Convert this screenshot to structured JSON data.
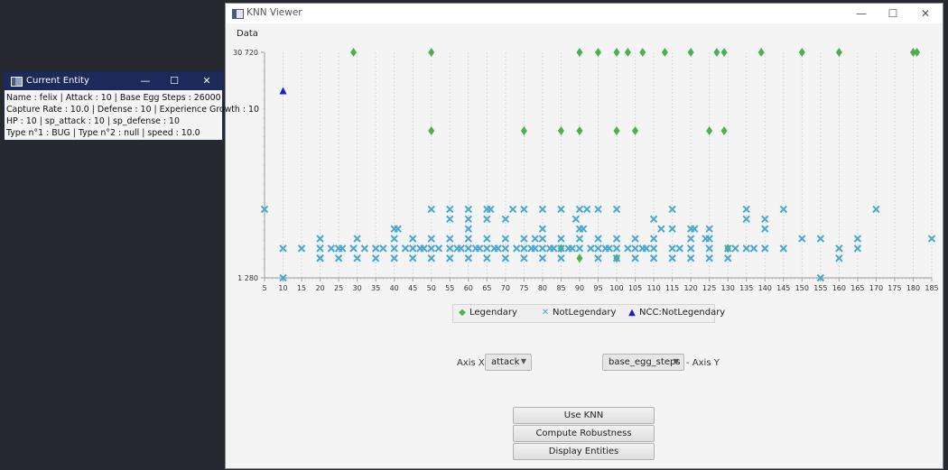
{
  "main_window": {
    "title": "KNN Viewer",
    "menu": [
      "Data"
    ],
    "controls": {
      "minimize": "—",
      "maximize": "☐",
      "close": "✕"
    }
  },
  "chart_data": {
    "type": "scatter",
    "x_ticks": [
      "5",
      "10",
      "15",
      "20",
      "25",
      "30",
      "35",
      "40",
      "45",
      "50",
      "55",
      "60",
      "65",
      "70",
      "75",
      "80",
      "85",
      "90",
      "95",
      "100",
      "105",
      "110",
      "115",
      "120",
      "125",
      "130",
      "135",
      "140",
      "145",
      "150",
      "155",
      "160",
      "165",
      "170",
      "175",
      "180",
      "185"
    ],
    "y_tick_labels": [
      "30 720",
      "1 280"
    ],
    "xlim": [
      5,
      185
    ],
    "ylim": [
      1280,
      30720
    ],
    "grid": true,
    "legend_position": "bottom",
    "series": [
      {
        "name": "Legendary",
        "marker": "diamond",
        "color": "#4cb050",
        "points": [
          [
            29,
            30720
          ],
          [
            50,
            30720
          ],
          [
            90,
            30720
          ],
          [
            95,
            30720
          ],
          [
            100,
            30720
          ],
          [
            103,
            30720
          ],
          [
            107,
            30720
          ],
          [
            113,
            30720
          ],
          [
            120,
            30720
          ],
          [
            127,
            30720
          ],
          [
            129,
            30720
          ],
          [
            139,
            30720
          ],
          [
            150,
            30720
          ],
          [
            160,
            30720
          ],
          [
            180,
            30720
          ],
          [
            181,
            30720
          ],
          [
            50,
            20480
          ],
          [
            75,
            20480
          ],
          [
            85,
            20480
          ],
          [
            90,
            20480
          ],
          [
            100,
            20480
          ],
          [
            105,
            20480
          ],
          [
            125,
            20480
          ],
          [
            129,
            20480
          ],
          [
            85,
            5120
          ],
          [
            90,
            3840
          ],
          [
            100,
            3840
          ],
          [
            130,
            5120
          ]
        ]
      },
      {
        "name": "NotLegendary",
        "marker": "x",
        "color": "#4aa8d0",
        "points": [
          [
            5,
            10240
          ],
          [
            10,
            5120
          ],
          [
            10,
            1280
          ],
          [
            15,
            5120
          ],
          [
            20,
            6400
          ],
          [
            20,
            5120
          ],
          [
            20,
            3840
          ],
          [
            20,
            3840
          ],
          [
            23,
            5120
          ],
          [
            25,
            5120
          ],
          [
            25,
            3840
          ],
          [
            26,
            5120
          ],
          [
            29,
            5120
          ],
          [
            30,
            6400
          ],
          [
            30,
            3840
          ],
          [
            32,
            5120
          ],
          [
            35,
            5120
          ],
          [
            35,
            3840
          ],
          [
            37,
            5120
          ],
          [
            40,
            7680
          ],
          [
            40,
            6400
          ],
          [
            40,
            5120
          ],
          [
            40,
            3840
          ],
          [
            41,
            7680
          ],
          [
            43,
            5120
          ],
          [
            45,
            6400
          ],
          [
            45,
            5120
          ],
          [
            45,
            3840
          ],
          [
            47,
            5120
          ],
          [
            48,
            5120
          ],
          [
            50,
            10240
          ],
          [
            50,
            6400
          ],
          [
            50,
            5120
          ],
          [
            50,
            3840
          ],
          [
            52,
            5120
          ],
          [
            55,
            10240
          ],
          [
            55,
            8960
          ],
          [
            55,
            6400
          ],
          [
            55,
            5120
          ],
          [
            55,
            3840
          ],
          [
            57,
            5120
          ],
          [
            58,
            5120
          ],
          [
            60,
            10240
          ],
          [
            60,
            8960
          ],
          [
            60,
            7680
          ],
          [
            60,
            6400
          ],
          [
            60,
            5120
          ],
          [
            60,
            3840
          ],
          [
            62,
            5120
          ],
          [
            63,
            5120
          ],
          [
            65,
            10240
          ],
          [
            65,
            8960
          ],
          [
            65,
            6400
          ],
          [
            65,
            5120
          ],
          [
            65,
            3840
          ],
          [
            66,
            10240
          ],
          [
            67,
            5120
          ],
          [
            68,
            5120
          ],
          [
            70,
            8960
          ],
          [
            70,
            6400
          ],
          [
            70,
            5120
          ],
          [
            70,
            3840
          ],
          [
            72,
            10240
          ],
          [
            73,
            5120
          ],
          [
            75,
            10240
          ],
          [
            75,
            6400
          ],
          [
            75,
            5120
          ],
          [
            75,
            3840
          ],
          [
            77,
            5120
          ],
          [
            78,
            5120
          ],
          [
            78,
            6400
          ],
          [
            80,
            10240
          ],
          [
            80,
            7680
          ],
          [
            80,
            6400
          ],
          [
            80,
            5120
          ],
          [
            80,
            3840
          ],
          [
            82,
            5120
          ],
          [
            83,
            5120
          ],
          [
            85,
            10240
          ],
          [
            85,
            6400
          ],
          [
            85,
            5120
          ],
          [
            85,
            3840
          ],
          [
            87,
            5120
          ],
          [
            88,
            5120
          ],
          [
            89,
            8960
          ],
          [
            90,
            10240
          ],
          [
            90,
            7680
          ],
          [
            90,
            6400
          ],
          [
            90,
            5120
          ],
          [
            91,
            7680
          ],
          [
            92,
            10240
          ],
          [
            93,
            5120
          ],
          [
            95,
            10240
          ],
          [
            95,
            6400
          ],
          [
            95,
            5120
          ],
          [
            95,
            3840
          ],
          [
            97,
            5120
          ],
          [
            98,
            5120
          ],
          [
            100,
            10240
          ],
          [
            100,
            6400
          ],
          [
            100,
            5120
          ],
          [
            100,
            3840
          ],
          [
            103,
            5120
          ],
          [
            105,
            6400
          ],
          [
            105,
            5120
          ],
          [
            105,
            3840
          ],
          [
            107,
            5120
          ],
          [
            108,
            5120
          ],
          [
            110,
            8960
          ],
          [
            110,
            6400
          ],
          [
            110,
            5120
          ],
          [
            110,
            3840
          ],
          [
            112,
            7680
          ],
          [
            115,
            10240
          ],
          [
            115,
            7680
          ],
          [
            115,
            5120
          ],
          [
            115,
            3840
          ],
          [
            117,
            5120
          ],
          [
            120,
            7680
          ],
          [
            120,
            6400
          ],
          [
            120,
            5120
          ],
          [
            120,
            3840
          ],
          [
            121,
            7680
          ],
          [
            124,
            6400
          ],
          [
            125,
            7680
          ],
          [
            125,
            6400
          ],
          [
            125,
            5120
          ],
          [
            125,
            3840
          ],
          [
            130,
            5120
          ],
          [
            130,
            3840
          ],
          [
            132,
            5120
          ],
          [
            135,
            10240
          ],
          [
            135,
            8960
          ],
          [
            135,
            5120
          ],
          [
            137,
            5120
          ],
          [
            140,
            8960
          ],
          [
            140,
            7680
          ],
          [
            140,
            5120
          ],
          [
            145,
            10240
          ],
          [
            145,
            5120
          ],
          [
            150,
            6400
          ],
          [
            155,
            6400
          ],
          [
            155,
            1280
          ],
          [
            160,
            5120
          ],
          [
            160,
            3840
          ],
          [
            165,
            6400
          ],
          [
            165,
            5120
          ],
          [
            170,
            10240
          ],
          [
            185,
            6400
          ]
        ]
      },
      {
        "name": "NCC:NotLegendary",
        "marker": "triangle",
        "color": "#1c1cc8",
        "points": [
          [
            10,
            25600
          ]
        ]
      }
    ]
  },
  "legend": {
    "items": [
      {
        "label": "Legendary",
        "symbol": "◆",
        "color": "#4cb050"
      },
      {
        "label": "NotLegendary",
        "symbol": "✕",
        "color": "#4aa8d0"
      },
      {
        "label": "NCC:NotLegendary",
        "symbol": "▲",
        "color": "#1c1cc8"
      }
    ]
  },
  "axis_select": {
    "x_label": "Axis X -",
    "x_value": "attack",
    "y_value": "base_egg_steps",
    "y_label": "- Axis Y"
  },
  "buttons": {
    "use_knn": "Use KNN",
    "compute_robustness": "Compute Robustness",
    "display_entities": "Display Entities"
  },
  "entity_window": {
    "title": "Current Entity",
    "lines": [
      "Name : felix | Attack : 10 | Base Egg Steps : 26000",
      "Capture Rate : 10.0 | Defense : 10 | Experience Growth : 10",
      "HP : 10 | sp_attack : 10 | sp_defense : 10",
      "Type n°1 : BUG | Type n°2 : null | speed : 10.0"
    ]
  }
}
